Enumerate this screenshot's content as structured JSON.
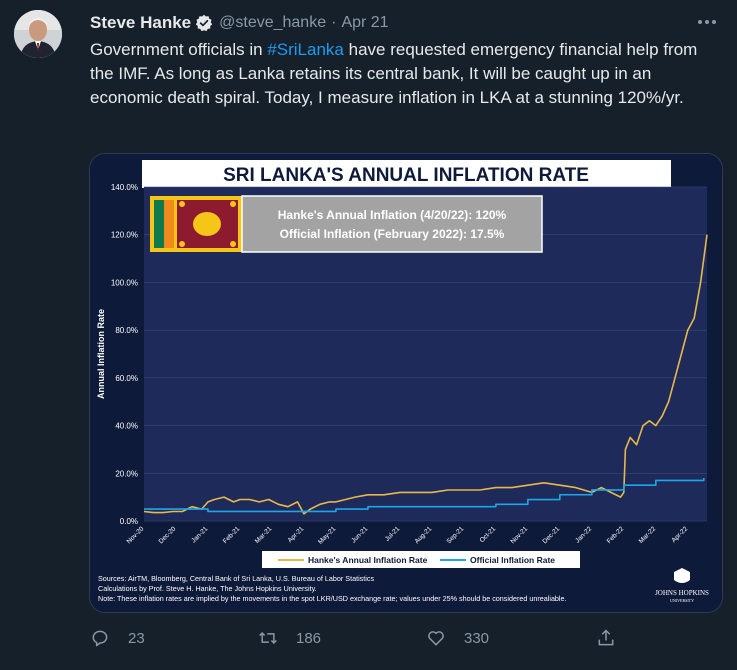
{
  "tweet": {
    "author_name": "Steve Hanke",
    "handle": "@steve_hanke",
    "separator": "·",
    "date": "Apr 21",
    "text_parts": {
      "before": "Government officials in ",
      "hashtag": "#SriLanka",
      "after": " have requested emergency financial help from the IMF. As long as Lanka retains its central bank, It will be caught up in an economic death spiral. Today, I measure inflation in LKA at a stunning 120%/yr."
    },
    "more_icon": "ellipsis-icon"
  },
  "actions": {
    "replies": "23",
    "retweets": "186",
    "likes": "330"
  },
  "colors": {
    "background": "#15202b",
    "accent": "#1d9bf0",
    "chart_bg": "#0d1a3a",
    "hanke_line": "#e8b84b",
    "official_line": "#1ea7e8"
  },
  "chart_data": {
    "type": "line",
    "title": "SRI LANKA'S ANNUAL INFLATION RATE",
    "ylabel": "Annual Inflation Rate",
    "ylim": [
      0,
      140
    ],
    "y_ticks": [
      "0.0%",
      "20.0%",
      "40.0%",
      "60.0%",
      "80.0%",
      "100.0%",
      "120.0%",
      "140.0%"
    ],
    "x_ticks": [
      "Nov-20",
      "Dec-20",
      "Jan-21",
      "Feb-21",
      "Mar-21",
      "Apr-21",
      "May-21",
      "Jun-21",
      "Jul-21",
      "Aug-21",
      "Sep-21",
      "Oct-21",
      "Nov-21",
      "Dec-21",
      "Jan-22",
      "Feb-22",
      "Mar-22",
      "Apr-22"
    ],
    "annotation": {
      "line1": "Hanke's Annual Inflation (4/20/22): 120%",
      "line2": "Official Inflation (February 2022): 17.5%"
    },
    "legend": {
      "hanke": "Hanke's Annual Inflation Rate",
      "official": "Official Inflation Rate",
      "placement": "bottom"
    },
    "series": [
      {
        "name": "Hanke's Annual Inflation Rate",
        "x": [
          0,
          0.3,
          0.6,
          0.9,
          1.2,
          1.5,
          1.8,
          2.0,
          2.2,
          2.5,
          2.8,
          3.0,
          3.3,
          3.6,
          3.9,
          4.2,
          4.5,
          4.8,
          5.0,
          5.2,
          5.5,
          5.8,
          6.0,
          6.3,
          6.6,
          7.0,
          7.5,
          8.0,
          8.5,
          9.0,
          9.5,
          10.0,
          10.5,
          11.0,
          11.5,
          12.0,
          12.5,
          13.0,
          13.5,
          14.0,
          14.3,
          14.6,
          14.9,
          15.0,
          15.05,
          15.2,
          15.4,
          15.6,
          15.8,
          16.0,
          16.2,
          16.4,
          16.6,
          16.8,
          17.0,
          17.2,
          17.4,
          17.5,
          17.6
        ],
        "values": [
          4,
          3.5,
          3.5,
          4,
          4,
          6,
          5,
          8,
          9,
          10,
          8,
          9,
          9,
          8,
          9,
          7,
          6,
          8,
          3,
          5,
          7,
          8,
          8,
          9,
          10,
          11,
          11,
          12,
          12,
          12,
          13,
          13,
          13,
          14,
          14,
          15,
          16,
          15,
          14,
          12,
          14,
          12,
          10,
          12,
          30,
          35,
          32,
          40,
          42,
          40,
          44,
          50,
          60,
          70,
          80,
          85,
          100,
          110,
          120
        ]
      },
      {
        "name": "Official Inflation Rate",
        "x": [
          0,
          1.0,
          1.5,
          2.0,
          3.0,
          4.0,
          5.0,
          6.0,
          7.0,
          8.0,
          9.0,
          10.0,
          11.0,
          12.0,
          13.0,
          14.0,
          15.0,
          16.0,
          17.0,
          17.5
        ],
        "values": [
          5,
          5,
          5,
          4,
          4,
          4,
          4,
          5,
          6,
          6,
          6,
          6,
          7,
          9,
          11,
          13,
          15,
          17,
          17,
          18
        ]
      }
    ],
    "sources": {
      "line1": "Sources: AirTM, Bloomberg, Central Bank of Sri Lanka, U.S. Bureau of Labor Statistics",
      "line2": "Calculations by Prof. Steve H. Hanke, The Johns Hopkins University.",
      "line3": "Note: These inflation rates are implied by the movements in the spot LKR/USD exchange rate; values under 25% should be considered unrealiable."
    },
    "logo": {
      "line1": "JOHNS HOPKINS",
      "line2": "UNIVERSITY"
    }
  }
}
